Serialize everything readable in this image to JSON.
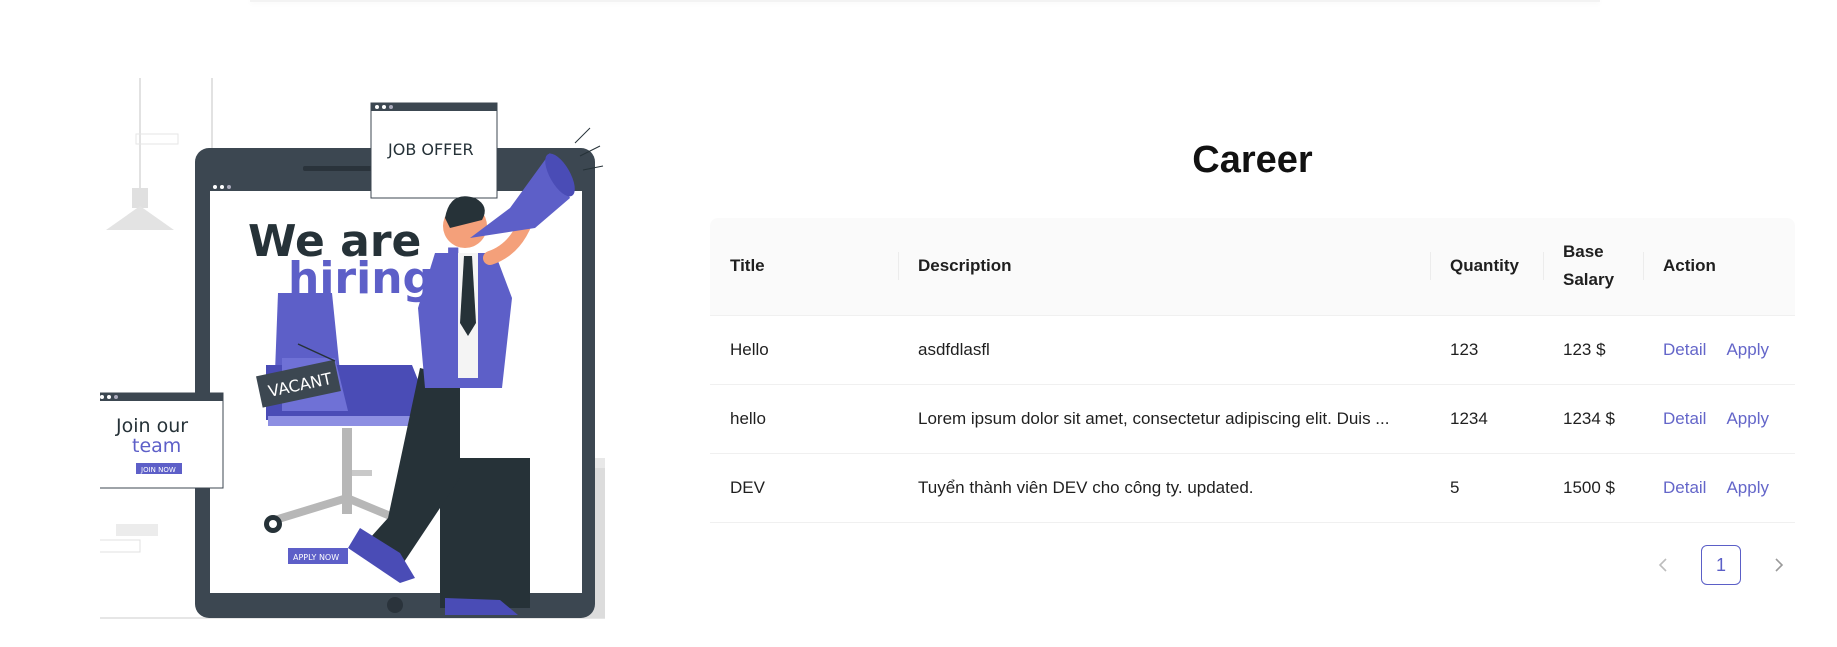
{
  "illustration": {
    "headline_line1": "We are",
    "headline_line2": "hiring",
    "headline_mark": "!",
    "job_offer_sign": "JOB OFFER",
    "vacant_sign": "VACANT",
    "join_line1": "Join our",
    "join_line2": "team",
    "join_button": "JOIN NOW",
    "apply_button": "APPLY NOW",
    "colors": {
      "accent": "#5d5fc8",
      "dark": "#3c4751",
      "pants": "#263238"
    }
  },
  "career": {
    "title": "Career",
    "columns": {
      "title": "Title",
      "description": "Description",
      "quantity": "Quantity",
      "base_salary_line1": "Base",
      "base_salary_line2": "Salary",
      "action": "Action"
    },
    "rows": [
      {
        "title": "Hello",
        "description": "asdfdlasfl",
        "quantity": "123",
        "salary": "123 $",
        "detail": "Detail",
        "apply": "Apply"
      },
      {
        "title": "hello",
        "description": "Lorem ipsum dolor sit amet, consectetur adipiscing elit. Duis ...",
        "quantity": "1234",
        "salary": "1234 $",
        "detail": "Detail",
        "apply": "Apply"
      },
      {
        "title": "DEV",
        "description": "Tuyển thành viên DEV cho công ty. updated.",
        "quantity": "5",
        "salary": "1500 $",
        "detail": "Detail",
        "apply": "Apply"
      }
    ],
    "pagination": {
      "prev_icon": "chevron-left-icon",
      "current_page": "1",
      "next_icon": "chevron-right-icon"
    },
    "colors": {
      "link": "#6466c9",
      "page_border": "#5b5fc7",
      "header_bg": "#fafafa"
    }
  }
}
